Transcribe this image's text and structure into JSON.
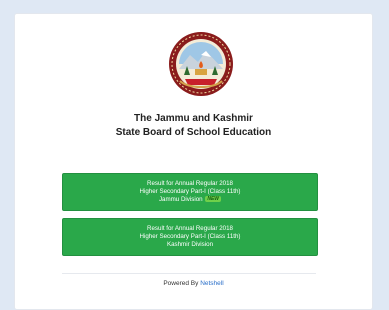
{
  "header": {
    "logo_text": "Jammu & Kashmir State Board of School Education",
    "title_line1": "The Jammu and Kashmir",
    "title_line2": "State Board of School Education"
  },
  "results": [
    {
      "line1": "Result for Annual Regular 2018",
      "line2": "Higher Secondary Part-I (Class 11th)",
      "line3": "Jammu Division",
      "badge": "NEW"
    },
    {
      "line1": "Result for Annual Regular 2018",
      "line2": "Higher Secondary Part-I (Class 11th)",
      "line3": "Kashmir Division"
    }
  ],
  "footer": {
    "prefix": "Powered By",
    "link": "Netshell"
  },
  "colors": {
    "button": "#2aa84a",
    "badge": "#6fd04a",
    "link": "#2a6fc9",
    "page_bg": "#dfe8f4"
  },
  "icons": {
    "logo": "board-seal-logo"
  }
}
